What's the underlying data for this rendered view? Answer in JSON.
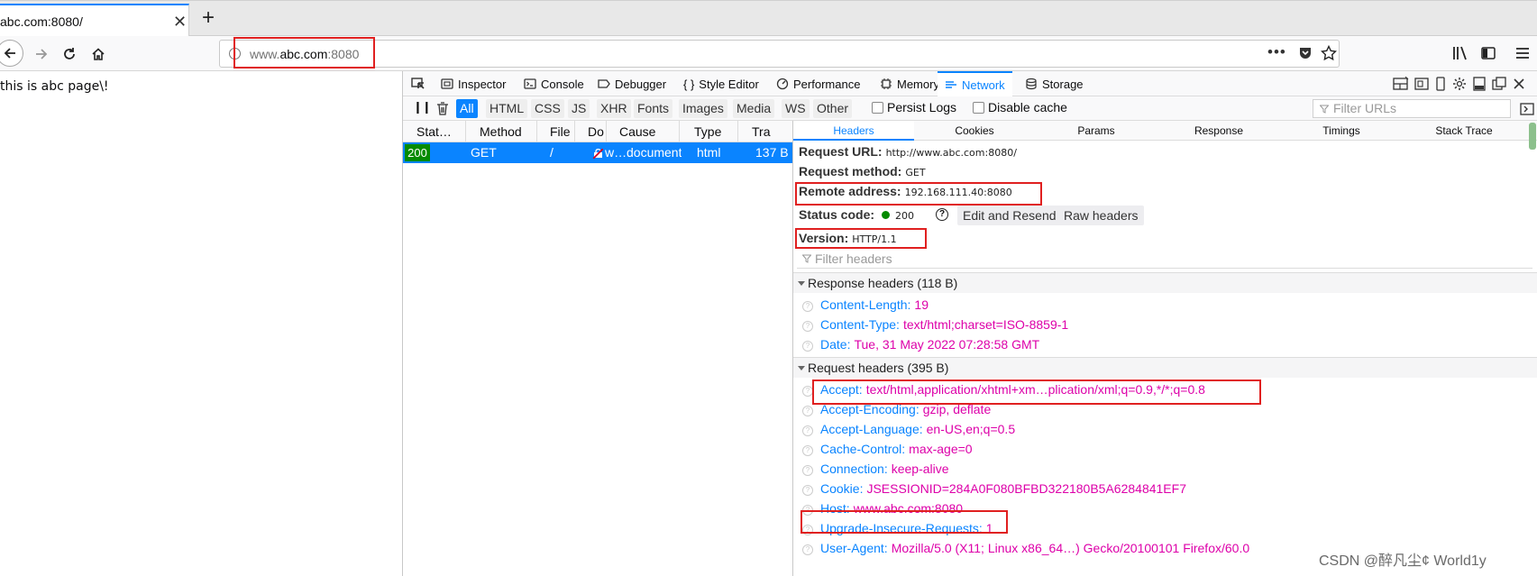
{
  "browser": {
    "tab_title": "abc.com:8080/",
    "tab_close": "✕",
    "new_tab": "+",
    "url_prefix": "www.",
    "url_host": "abc.com",
    "url_port": ":8080",
    "url_more": "•••"
  },
  "page": {
    "text": "this is abc page\\!"
  },
  "devtools": {
    "tabs": [
      "Inspector",
      "Console",
      "Debugger",
      "Style Editor",
      "Performance",
      "Memory",
      "Network",
      "Storage"
    ],
    "filters": [
      "All",
      "HTML",
      "CSS",
      "JS",
      "XHR",
      "Fonts",
      "Images",
      "Media",
      "WS",
      "Other"
    ],
    "persist_logs": "Persist Logs",
    "disable_cache": "Disable cache",
    "filter_urls_placeholder": "Filter URLs",
    "columns": [
      "Stat…",
      "Method",
      "File",
      "Do",
      "Cause",
      "Type",
      "Tra"
    ],
    "request": {
      "status": "200",
      "method": "GET",
      "file": "/",
      "domain": "w…",
      "cause": "document",
      "type": "html",
      "transferred": "137 B"
    },
    "detail_tabs": [
      "Headers",
      "Cookies",
      "Params",
      "Response",
      "Timings",
      "Stack Trace"
    ],
    "summary": {
      "url_label": "Request URL:",
      "url_value": "http://www.abc.com:8080/",
      "method_label": "Request method:",
      "method_value": "GET",
      "remote_label": "Remote address:",
      "remote_value": "192.168.111.40:8080",
      "status_label": "Status code:",
      "status_value": "200",
      "edit_resend": "Edit and Resend",
      "raw_headers": "Raw headers",
      "version_label": "Version:",
      "version_value": "HTTP/1.1"
    },
    "filter_headers_placeholder": "Filter headers",
    "response_headers_title": "Response headers (118 B)",
    "response_headers": [
      {
        "name": "Content-Length:",
        "value": "19"
      },
      {
        "name": "Content-Type:",
        "value": "text/html;charset=ISO-8859-1"
      },
      {
        "name": "Date:",
        "value": "Tue, 31 May 2022 07:28:58 GMT"
      }
    ],
    "request_headers_title": "Request headers (395 B)",
    "request_headers": [
      {
        "name": "Accept:",
        "value": "text/html,application/xhtml+xm…plication/xml;q=0.9,*/*;q=0.8"
      },
      {
        "name": "Accept-Encoding:",
        "value": "gzip, deflate"
      },
      {
        "name": "Accept-Language:",
        "value": "en-US,en;q=0.5"
      },
      {
        "name": "Cache-Control:",
        "value": "max-age=0"
      },
      {
        "name": "Connection:",
        "value": "keep-alive"
      },
      {
        "name": "Cookie:",
        "value": "JSESSIONID=284A0F080BFBD322180B5A6284841EF7"
      },
      {
        "name": "Host:",
        "value": "www.abc.com:8080"
      },
      {
        "name": "Upgrade-Insecure-Requests:",
        "value": "1"
      },
      {
        "name": "User-Agent:",
        "value": "Mozilla/5.0 (X11; Linux x86_64…) Gecko/20100101 Firefox/60.0"
      }
    ]
  },
  "watermark": "CSDN @醉凡尘¢ World1y",
  "colors": {
    "accent": "#0a84ff",
    "header_value": "#dd00a9",
    "status_ok": "#058b00",
    "highlight_box": "#e02020"
  }
}
